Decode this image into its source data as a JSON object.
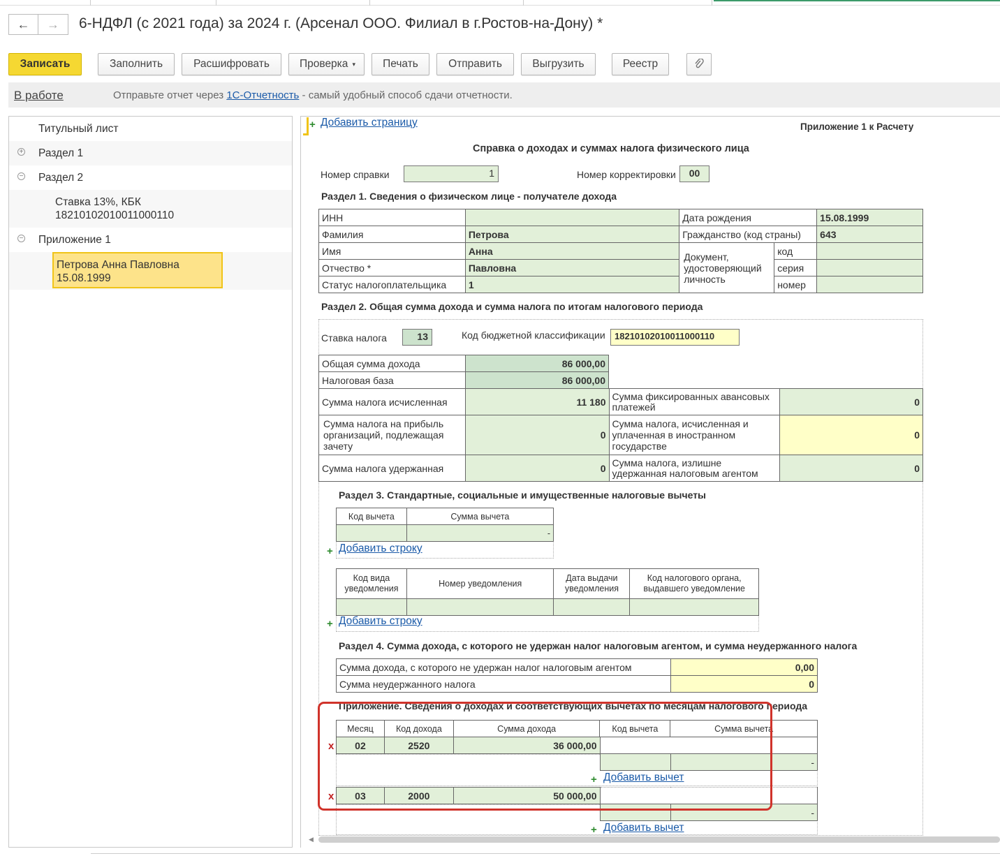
{
  "window": {
    "title": "6-НДФЛ (с 2021 года) за 2024 г. (Арсенал ООО. Филиал в г.Ростов-на-Дону) *",
    "back_icon": "←",
    "forward_icon": "→"
  },
  "toolbar": {
    "save": "Записать",
    "fill": "Заполнить",
    "decode": "Расшифровать",
    "check": "Проверка",
    "print": "Печать",
    "send": "Отправить",
    "export": "Выгрузить",
    "registry": "Реестр",
    "attach_icon": "⌀"
  },
  "status": {
    "state": "В работе",
    "msg_prefix": "Отправьте отчет через ",
    "msg_link": "1С-Отчетность",
    "msg_suffix": " - самый удобный способ сдачи отчетности."
  },
  "tree": {
    "title_sheet": "Титульный лист",
    "section1": "Раздел 1",
    "section2": "Раздел 2",
    "rate_kbk_line1": "Ставка 13%, КБК",
    "rate_kbk_line2": "18210102010011000110",
    "appendix1": "Приложение 1",
    "person_line1": "Петрова Анна Павловна",
    "person_line2": "15.08.1999",
    "expand": "+",
    "collapse": "−"
  },
  "form": {
    "add_page": "Добавить страницу",
    "appendix_title": "Приложение 1 к Расчету",
    "heading": "Справка о доходах и суммах налога физического лица",
    "cert_num_label": "Номер справки",
    "cert_num": "1",
    "corr_label": "Номер корректировки",
    "corr": "00",
    "s1": {
      "title": "Раздел 1. Сведения о физическом лице - получателе дохода",
      "inn_label": "ИНН",
      "inn": "",
      "surname_label": "Фамилия",
      "surname": "Петрова",
      "name_label": "Имя",
      "name": "Анна",
      "patronymic_label": "Отчество *",
      "patronymic": "Павловна",
      "status_label": "Статус налогоплательщика",
      "status": "1",
      "birth_label": "Дата рождения",
      "birth": "15.08.1999",
      "citizenship_label": "Гражданство (код страны)",
      "citizenship": "643",
      "doc_label": "Документ, удостоверяющий личность",
      "doc_code_label": "код",
      "doc_series_label": "серия",
      "doc_number_label": "номер"
    },
    "s2": {
      "title": "Раздел 2. Общая сумма дохода и сумма налога по итогам налогового периода",
      "rate_label": "Ставка налога",
      "rate": "13",
      "kbk_label": "Код бюджетной классификации",
      "kbk": "18210102010011000110",
      "income_label": "Общая сумма дохода",
      "income": "86 000,00",
      "base_label": "Налоговая база",
      "base": "86 000,00",
      "tax_calc_label": "Сумма налога исчисленная",
      "tax_calc": "11 180",
      "fixed_adv_label": "Сумма фиксированных авансовых платежей",
      "fixed_adv": "0",
      "profit_tax_label": "Сумма налога на прибыль организаций, подлежащая зачету",
      "profit_tax": "0",
      "foreign_tax_label": "Сумма налога, исчисленная и уплаченная в иностранном государстве",
      "foreign_tax": "0",
      "withheld_label": "Сумма налога удержанная",
      "withheld": "0",
      "excess_label": "Сумма налога, излишне удержанная налоговым агентом",
      "excess": "0"
    },
    "s3": {
      "title": "Раздел 3. Стандартные, социальные и имущественные налоговые вычеты",
      "col_code": "Код вычета",
      "col_sum": "Сумма вычета",
      "row_sum": "-",
      "add_row": "Добавить строку",
      "n_col_kind": "Код вида уведомления",
      "n_col_num": "Номер уведомления",
      "n_col_date": "Дата выдачи уведомления",
      "n_col_org": "Код налогового органа, выдавшего уведомление",
      "add_row2": "Добавить строку"
    },
    "s4": {
      "title": "Раздел 4. Сумма дохода, с которого не удержан налог налоговым агентом, и сумма неудержанного налога",
      "notheld_income_label": "Сумма дохода, с которого не удержан налог налоговым агентом",
      "notheld_income": "0,00",
      "notheld_tax_label": "Сумма неудержанного налога",
      "notheld_tax": "0"
    },
    "app": {
      "title": "Приложение. Сведения о доходах и соответствующих вычетах по месяцам налогового периода",
      "col_month": "Месяц",
      "col_code": "Код дохода",
      "col_sum": "Сумма дохода",
      "col_ded_code": "Код вычета",
      "col_ded_sum": "Сумма вычета",
      "delete": "x",
      "ded_sum_empty": "-",
      "add_deduction": "Добавить вычет",
      "rows": [
        {
          "month": "02",
          "code": "2520",
          "sum": "36 000,00"
        },
        {
          "month": "03",
          "code": "2000",
          "sum": "50 000,00"
        }
      ]
    }
  }
}
